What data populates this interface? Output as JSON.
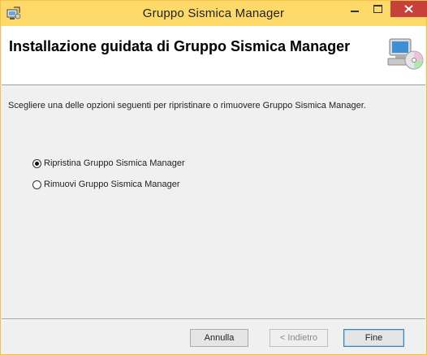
{
  "window": {
    "title": "Gruppo Sismica Manager",
    "accent_color": "#fdd969",
    "close_color": "#c7403a"
  },
  "header": {
    "title": "Installazione guidata di Gruppo Sismica Manager",
    "icon": "computer-cd-icon"
  },
  "content": {
    "instructions": "Scegliere una delle opzioni seguenti per ripristinare o rimuovere Gruppo Sismica Manager.",
    "options": [
      {
        "label": "Ripristina Gruppo Sismica Manager",
        "selected": true
      },
      {
        "label": "Rimuovi Gruppo Sismica Manager",
        "selected": false
      }
    ]
  },
  "buttons": {
    "cancel": "Annulla",
    "back": "< Indietro",
    "finish": "Fine"
  }
}
